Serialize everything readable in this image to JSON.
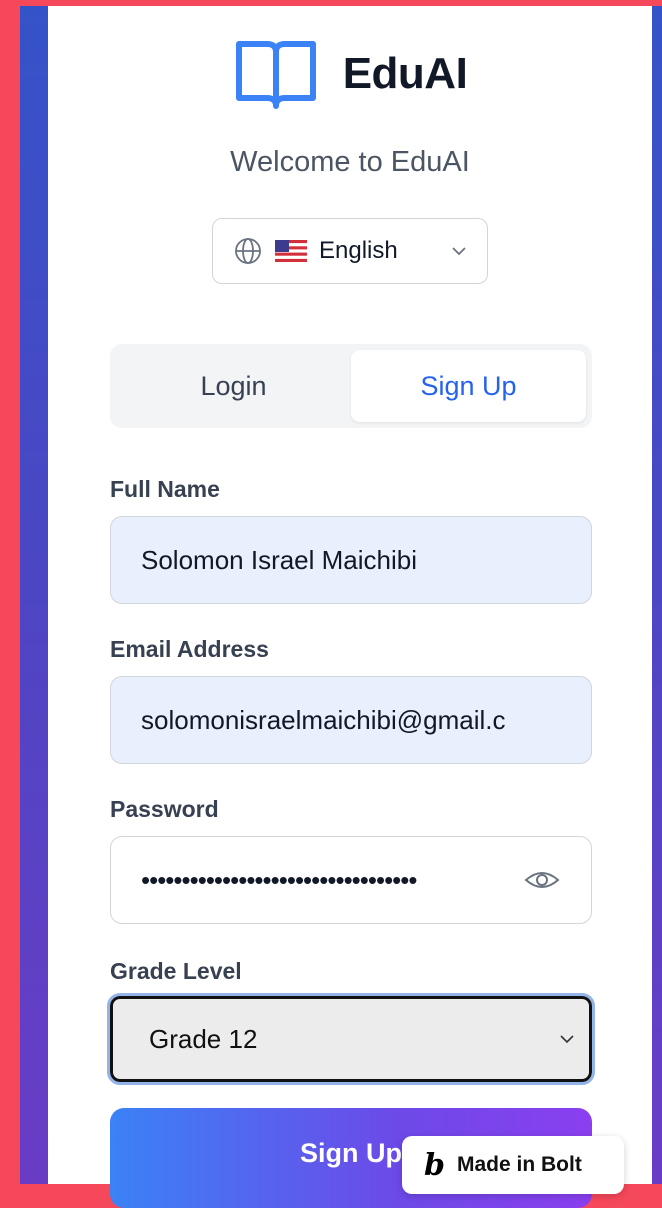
{
  "brand": {
    "name": "EduAI",
    "icon": "book-open-icon",
    "accent": "#3b82f6"
  },
  "welcome": "Welcome to EduAI",
  "language": {
    "icon": "globe-icon",
    "flag": "us-flag-icon",
    "selected": "English"
  },
  "tabs": [
    {
      "label": "Login",
      "active": false
    },
    {
      "label": "Sign Up",
      "active": true
    }
  ],
  "form": {
    "full_name": {
      "label": "Full Name",
      "value": "Solomon Israel Maichibi"
    },
    "email": {
      "label": "Email Address",
      "value": "solomonisraelmaichibi@gmail.c"
    },
    "password": {
      "label": "Password",
      "masked": "••••••••••••••••••••••••••••••••••",
      "icon": "eye-icon"
    },
    "grade": {
      "label": "Grade Level",
      "selected": "Grade 12"
    },
    "submit_label": "Sign Up"
  },
  "badge": {
    "logo": "b",
    "label": "Made in Bolt"
  }
}
